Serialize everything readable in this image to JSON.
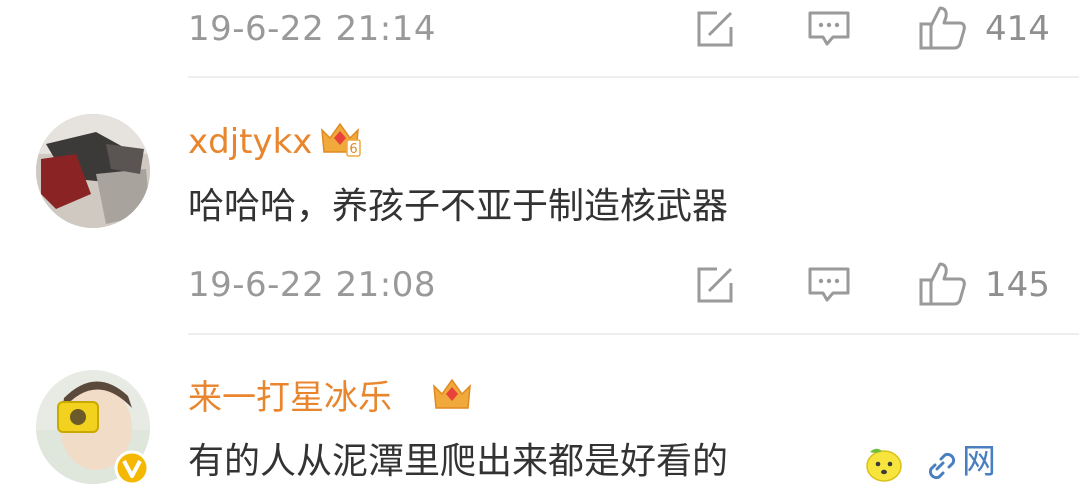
{
  "comments": [
    {
      "time": "19-6-22 21:14",
      "likes": "414"
    },
    {
      "username": "xdjtykx",
      "content": "哈哈哈，养孩子不亚于制造核武器",
      "time": "19-6-22 21:08",
      "likes": "145",
      "badge_level": "6"
    },
    {
      "username": "来一打星冰乐",
      "content": "有的人从泥潭里爬出来都是好看的",
      "link_text": "网"
    }
  ],
  "icons": {
    "repost": "share-box-icon",
    "comment": "comment-bubble-icon",
    "like": "thumbs-up-icon",
    "vip": "crown-badge-icon",
    "verified": "verified-v-icon",
    "emoji": "lemon-face-icon",
    "link": "chain-link-icon"
  },
  "colors": {
    "username": "#e8852d",
    "meta": "#999999",
    "content": "#333333",
    "link": "#4a7fbf",
    "crown": "#f2a93b"
  }
}
